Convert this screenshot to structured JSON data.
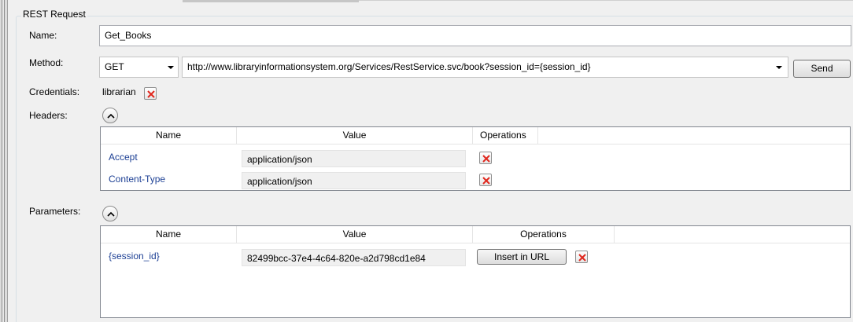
{
  "group_title": "REST Request",
  "name": {
    "label": "Name:",
    "value": "Get_Books"
  },
  "method": {
    "label": "Method:",
    "value": "GET",
    "url": "http://www.libraryinformationsystem.org/Services/RestService.svc/book?session_id={session_id}",
    "send_label": "Send"
  },
  "credentials": {
    "label": "Credentials:",
    "value": "librarian"
  },
  "headers": {
    "label": "Headers:",
    "columns": [
      "Name",
      "Value",
      "Operations"
    ],
    "rows": [
      {
        "name": "Accept",
        "value": "application/json"
      },
      {
        "name": "Content-Type",
        "value": "application/json"
      }
    ]
  },
  "parameters": {
    "label": "Parameters:",
    "columns": [
      "Name",
      "Value",
      "Operations"
    ],
    "rows": [
      {
        "name": "{session_id}",
        "value": "82499bcc-37e4-4c64-820e-a2d798cd1e84",
        "insert_label": "Insert in URL"
      }
    ]
  },
  "colors": {
    "link_text": "#1c3f94",
    "remove_icon": "#e0281e"
  }
}
